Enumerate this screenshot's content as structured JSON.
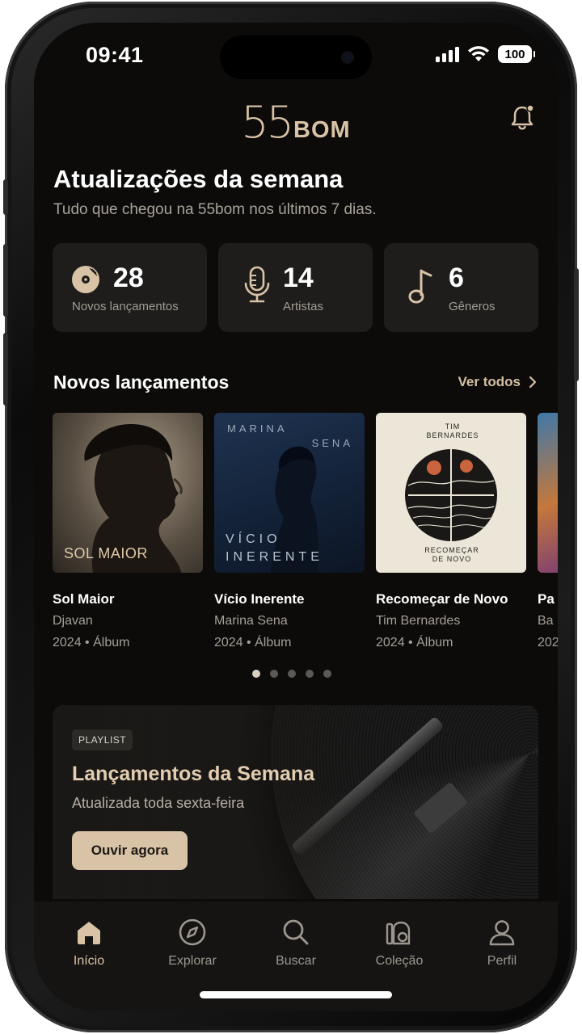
{
  "status_bar": {
    "time": "09:41",
    "battery": "100"
  },
  "header": {
    "logo_number": "55",
    "logo_word": "BOM"
  },
  "weekly": {
    "title": "Atualizações da semana",
    "subtitle": "Tudo que chegou na 55bom nos últimos 7 dias."
  },
  "stats": [
    {
      "value": "28",
      "label": "Novos lançamentos",
      "icon": "vinyl-disc-icon"
    },
    {
      "value": "14",
      "label": "Artistas",
      "icon": "microphone-icon"
    },
    {
      "value": "6",
      "label": "Gêneros",
      "icon": "music-note-icon"
    }
  ],
  "new_releases": {
    "title": "Novos lançamentos",
    "see_all": "Ver todos",
    "items": [
      {
        "title": "Sol Maior",
        "artist": "Djavan",
        "meta": "2024 • Álbum",
        "cover_text": "SOL MAIOR"
      },
      {
        "title": "Vício Inerente",
        "artist": "Marina Sena",
        "meta": "2024 • Álbum",
        "cover_text_top_left": "MARINA",
        "cover_text_top_right": "SENA",
        "cover_text_bottom": "VÍCIO INERENTE"
      },
      {
        "title": "Recomeçar de Novo",
        "artist": "Tim Bernardes",
        "meta": "2024 • Álbum",
        "cover_text_top": "TIM BERNARDES",
        "cover_text_bottom": "RECOMEÇAR DE NOVO"
      },
      {
        "title": "Pa",
        "artist": "Ba",
        "meta": "202"
      }
    ],
    "pager_count": 5,
    "pager_active": 0
  },
  "playlist_banner": {
    "tag": "PLAYLIST",
    "title": "Lançamentos da Semana",
    "subtitle": "Atualizada toda sexta-feira",
    "cta": "Ouvir agora"
  },
  "tabbar": [
    {
      "label": "Início",
      "icon": "home-icon",
      "active": true
    },
    {
      "label": "Explorar",
      "icon": "compass-icon",
      "active": false
    },
    {
      "label": "Buscar",
      "icon": "search-icon",
      "active": false
    },
    {
      "label": "Coleção",
      "icon": "collection-icon",
      "active": false
    },
    {
      "label": "Perfil",
      "icon": "profile-icon",
      "active": false
    }
  ],
  "colors": {
    "accent": "#d9c3a6",
    "background": "#0c0b0a",
    "card": "#1e1d1c"
  }
}
